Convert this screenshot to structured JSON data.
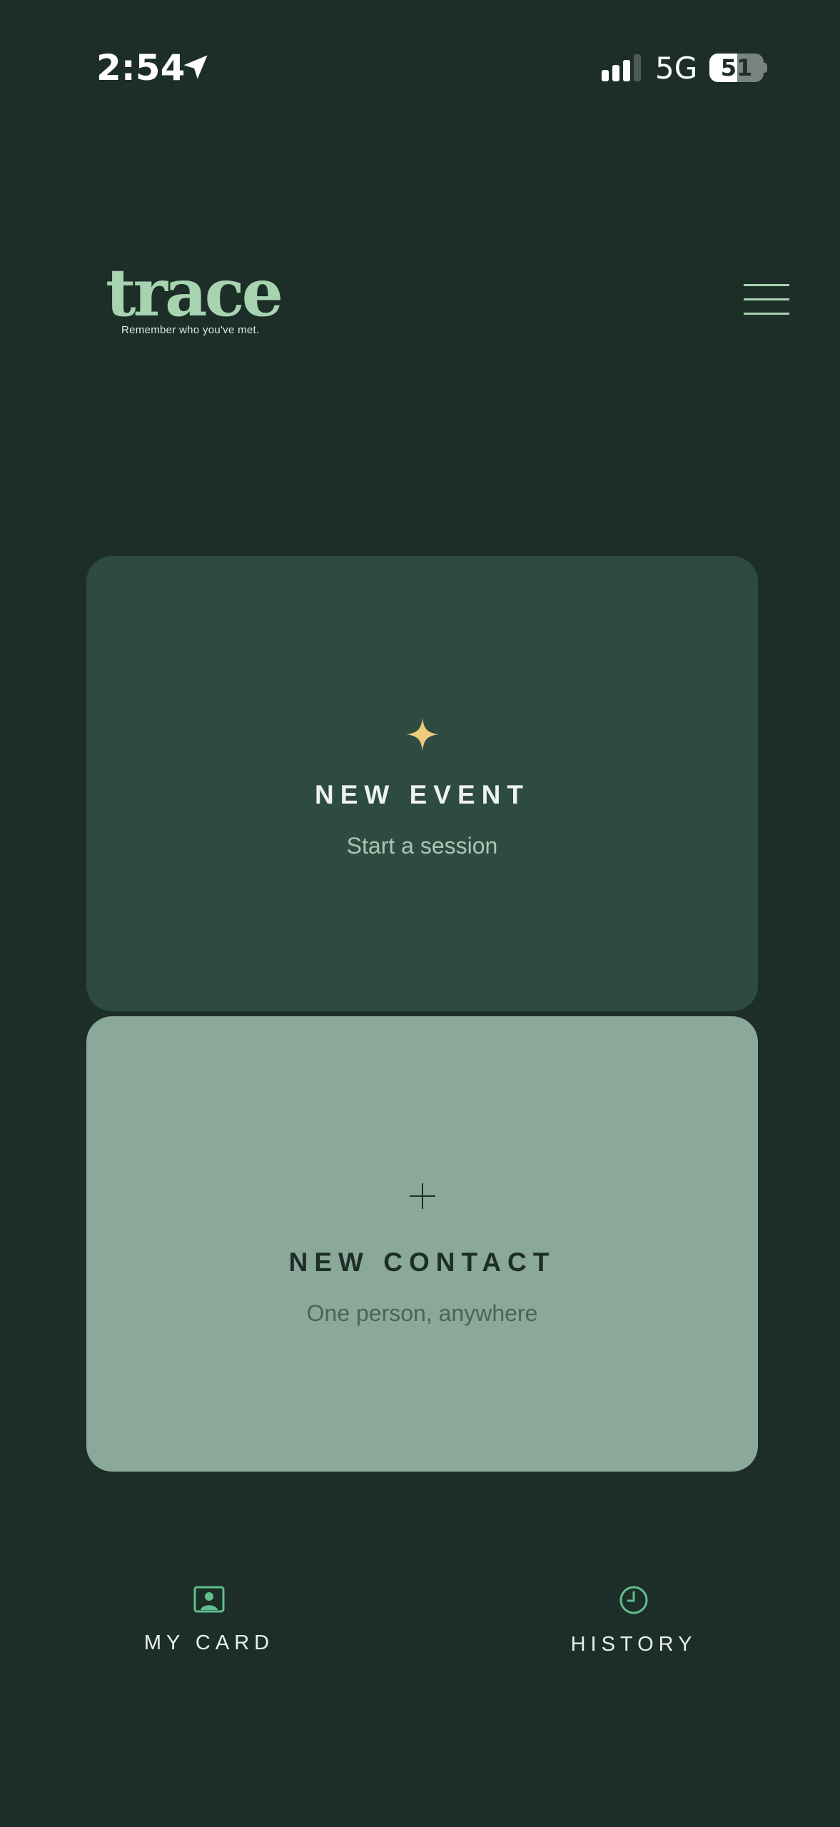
{
  "status_bar": {
    "time": "2:54",
    "network": "5G",
    "battery_percent": 51,
    "battery_text": "51",
    "signal_bars_active": 3,
    "signal_bars_total": 4
  },
  "header": {
    "logo_text": "trace",
    "tagline": "Remember who you've met.",
    "menu_icon": "hamburger-menu-icon"
  },
  "cards": {
    "new_event": {
      "icon": "sparkle-icon",
      "title": "NEW EVENT",
      "subtitle": "Start a session"
    },
    "new_contact": {
      "icon": "plus-icon",
      "title": "NEW CONTACT",
      "subtitle": "One person, anywhere"
    }
  },
  "nav": {
    "my_card": {
      "icon": "id-card-icon",
      "label": "MY CARD"
    },
    "history": {
      "icon": "clock-icon",
      "label": "HISTORY"
    }
  },
  "colors": {
    "background": "#1c2e27",
    "accent_green": "#a8d3b1",
    "event_card": "#2d4b40",
    "contact_card": "#8ba99a",
    "sparkle": "#eccb7d",
    "nav_icon": "#5fbf8f"
  }
}
